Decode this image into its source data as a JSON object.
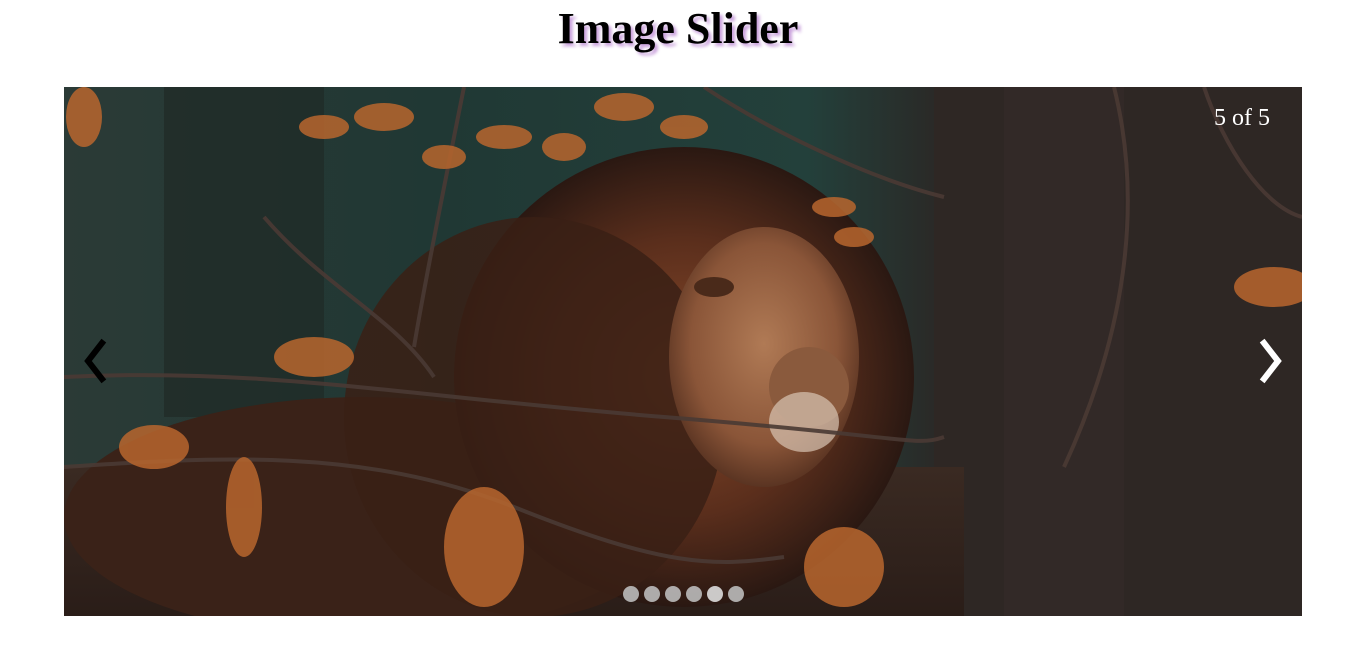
{
  "header": {
    "title": "Image Slider"
  },
  "slider": {
    "counter": "5 of 5",
    "current_slide": 5,
    "total_slides": 5,
    "image_subject": "lion-in-autumn-forest",
    "dot_count": 6,
    "active_dot": 5,
    "prev_icon": "chevron-left-icon",
    "next_icon": "chevron-right-icon"
  },
  "colors": {
    "title_shadow": "#c9a0dc",
    "counter_text": "#ffffff",
    "dot": "#bbbbbb",
    "prev_arrow": "#000000",
    "next_arrow": "#ffffff"
  }
}
